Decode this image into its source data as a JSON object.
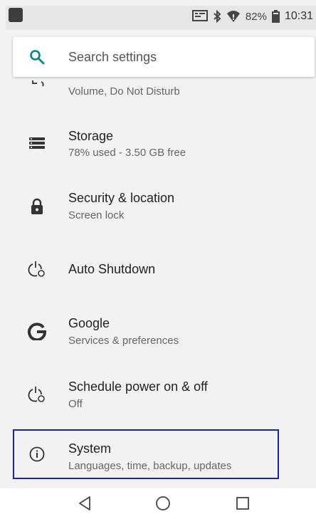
{
  "status_bar": {
    "battery": "82%",
    "time": "10:31"
  },
  "search": {
    "placeholder": "Search settings"
  },
  "partial_item": {
    "subtitle": "Volume, Do Not Disturb"
  },
  "items": [
    {
      "icon": "storage-icon",
      "title": "Storage",
      "subtitle": "78% used - 3.50 GB free"
    },
    {
      "icon": "lock-icon",
      "title": "Security & location",
      "subtitle": "Screen lock"
    },
    {
      "icon": "power-clock-icon",
      "title": "Auto Shutdown",
      "subtitle": ""
    },
    {
      "icon": "google-icon",
      "title": "Google",
      "subtitle": "Services & preferences"
    },
    {
      "icon": "power-clock-icon",
      "title": "Schedule power on & off",
      "subtitle": "Off"
    },
    {
      "icon": "info-icon",
      "title": "System",
      "subtitle": "Languages, time, backup, updates"
    }
  ],
  "colors": {
    "accent": "#00897b",
    "highlight": "#1a22a8"
  }
}
